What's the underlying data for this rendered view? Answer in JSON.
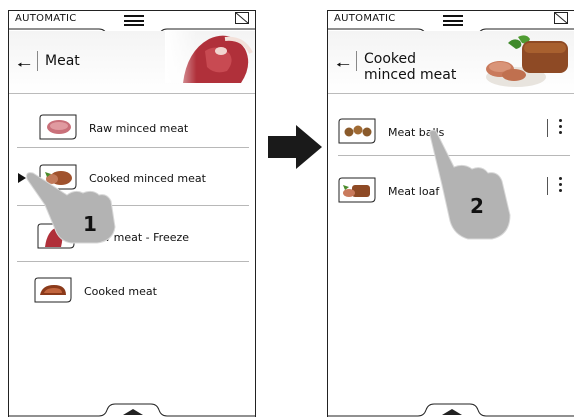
{
  "colors": {
    "frame": "#222222",
    "divider": "#b8b8b8",
    "hand": "#b5b5b5",
    "arrow": "#1a1a1a"
  },
  "left_screen": {
    "mode": "AUTOMATIC",
    "title": "Meat",
    "header_image": "raw-steak",
    "items": [
      {
        "label": "Raw minced meat",
        "icon": "raw-minced-meat-thumb"
      },
      {
        "label": "Cooked minced meat",
        "icon": "cooked-minced-meat-thumb"
      },
      {
        "label": "Raw meat - Freeze",
        "icon": "raw-meat-freeze-thumb"
      },
      {
        "label": "Cooked meat",
        "icon": "cooked-meat-thumb"
      }
    ],
    "step": "1"
  },
  "right_screen": {
    "mode": "AUTOMATIC",
    "title_line1": "Cooked",
    "title_line2": "minced meat",
    "header_image": "meat-loaf-plate",
    "items": [
      {
        "label": "Meat balls",
        "icon": "meat-balls-thumb"
      },
      {
        "label": "Meat loaf",
        "icon": "meat-loaf-thumb"
      }
    ],
    "step": "2"
  }
}
